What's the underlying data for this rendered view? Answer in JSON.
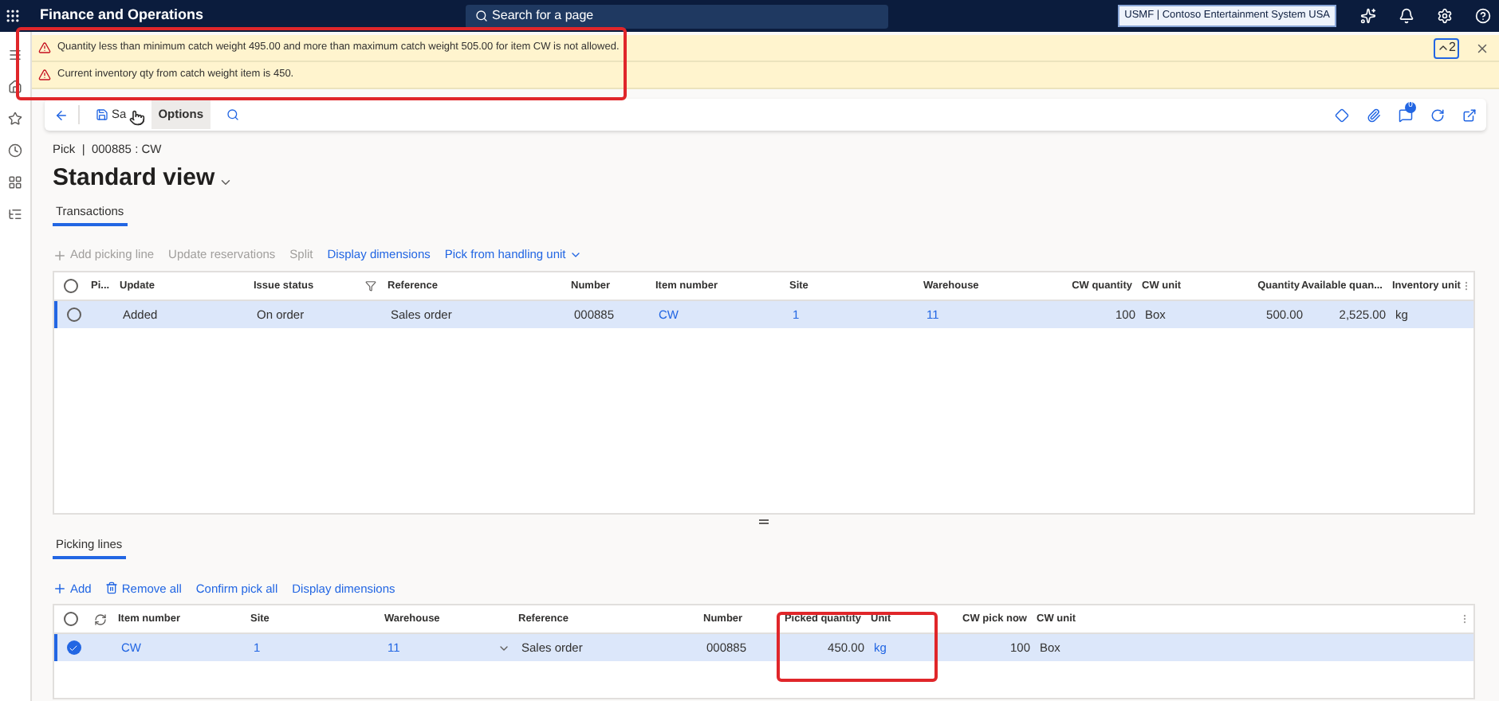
{
  "app_bar": {
    "title": "Finance and Operations",
    "search": {
      "placeholder": "Search for a page"
    },
    "company": "USMF | Contoso Entertainment System USA"
  },
  "messages": [
    {
      "kind": "warning",
      "text": "Quantity less than minimum catch weight 495.00 and more than maximum catch weight 505.00 for item CW is not allowed."
    },
    {
      "kind": "warning",
      "text": "Current inventory qty from catch weight item is 450."
    }
  ],
  "message_count": "2",
  "action_pane": {
    "items": [
      {
        "label": "Sa",
        "selected": false
      },
      {
        "label": "Options",
        "selected": true
      }
    ],
    "badge": "0"
  },
  "breadcrumb": "Pick  |  000885 : CW",
  "view_title": "Standard view",
  "sections": [
    {
      "tab": {
        "label": "Transactions",
        "selected": true
      },
      "toolbar": [
        {
          "kind": "add",
          "label": "Add picking line",
          "disabled": true
        },
        {
          "kind": "plain",
          "label": "Update reservations",
          "disabled": true
        },
        {
          "kind": "plain",
          "label": "Split",
          "disabled": true
        },
        {
          "kind": "plain",
          "label": "Display dimensions",
          "disabled": false
        },
        {
          "kind": "menu",
          "label": "Pick from handling unit",
          "disabled": false
        }
      ],
      "refresh_column": false,
      "all_checked": false,
      "columns": [
        {
          "label": "Pi...",
          "kind": "text",
          "filtered": false
        },
        {
          "label": "Update",
          "kind": "text",
          "filtered": false
        },
        {
          "label": "Issue status",
          "kind": "text",
          "filtered": true
        },
        {
          "label": "Reference",
          "kind": "text",
          "filtered": false
        },
        {
          "label": "Number",
          "kind": "text",
          "filtered": false
        },
        {
          "label": "Item number",
          "kind": "link",
          "filtered": false
        },
        {
          "label": "Site",
          "kind": "link",
          "filtered": false
        },
        {
          "label": "Warehouse",
          "kind": "link",
          "filtered": false
        },
        {
          "label": "CW quantity",
          "kind": "number",
          "filtered": false
        },
        {
          "label": "CW unit",
          "kind": "text",
          "filtered": false
        },
        {
          "label": "Quantity",
          "kind": "number",
          "filtered": false
        },
        {
          "label": "Available quan...",
          "kind": "number",
          "filtered": false
        },
        {
          "label": "Inventory unit",
          "kind": "text",
          "filtered": false
        }
      ],
      "rows": [
        {
          "selected": true,
          "checked": false,
          "cells": [
            null,
            "Added",
            "On order",
            "Sales order",
            "000885",
            "CW",
            "1",
            "11",
            "100",
            "Box",
            "500.00",
            "2,525.00",
            "kg"
          ]
        }
      ]
    },
    {
      "tab": {
        "label": "Picking lines",
        "selected": true
      },
      "toolbar": [
        {
          "kind": "add",
          "label": "Add",
          "disabled": false
        },
        {
          "kind": "remove",
          "label": "Remove all",
          "disabled": false
        },
        {
          "kind": "plain",
          "label": "Confirm pick all",
          "disabled": false
        },
        {
          "kind": "plain",
          "label": "Display dimensions",
          "disabled": false
        }
      ],
      "refresh_column": true,
      "all_checked": false,
      "columns": [
        {
          "label": "Item number",
          "kind": "link",
          "filtered": false
        },
        {
          "label": "Site",
          "kind": "link",
          "filtered": false
        },
        {
          "label": "Warehouse",
          "kind": "lookup",
          "filtered": false
        },
        {
          "label": "Reference",
          "kind": "text",
          "filtered": false
        },
        {
          "label": "Number",
          "kind": "text",
          "filtered": false
        },
        {
          "label": "Picked quantity",
          "kind": "number",
          "filtered": false
        },
        {
          "label": "Unit",
          "kind": "link",
          "filtered": false
        },
        {
          "label": "CW pick now",
          "kind": "number",
          "filtered": false
        },
        {
          "label": "CW unit",
          "kind": "text",
          "filtered": false
        }
      ],
      "rows": [
        {
          "selected": true,
          "checked": true,
          "cells": [
            "CW",
            "1",
            "11",
            "Sales order",
            "000885",
            "450.00",
            "kg",
            "100",
            "Box"
          ]
        }
      ]
    }
  ]
}
